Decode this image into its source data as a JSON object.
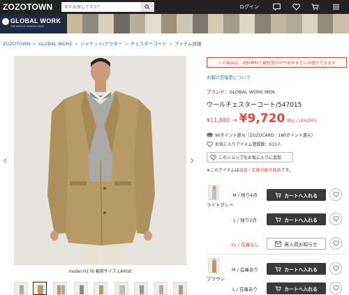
{
  "header": {
    "logo": "ZOZOTOWN",
    "search_placeholder": "何かお探しですか？",
    "login": "ログイン",
    "icons": [
      "search-icon",
      "message-icon",
      "heart-icon",
      "cart-icon",
      "menu-icon"
    ]
  },
  "banner": {
    "brand": "GLOBAL WORK",
    "tagline": "THE WORLD FASHION MART"
  },
  "breadcrumb": [
    "ZOZOTOWN",
    "GLOBAL WORK",
    "ジャケット/アウター",
    "チェスターコート",
    "アイテム詳細"
  ],
  "product": {
    "caption": "model:H178 着用サイズ:LARGE",
    "notice": "この商品は、送料無料で最短翌日の午前中までにお届けできます",
    "delivery_link": "お届け日指定について",
    "brand_line": "ブランド：GLOBAL WORK MEN",
    "title": "ウールチェスターコート/547015",
    "price_old": "¥11,880",
    "price_arrow": "→",
    "price_new": "¥9,720",
    "price_tax": "税込",
    "price_off": "(18%OFF)",
    "points": "90ポイント還元（ZOZOCARD：180ポイント還元）",
    "favorites": "お気に入りアイテム登録数：915人",
    "shop_fav": "このショップをお気に入りに追加",
    "return_note": {
      "prefix": "※このアイテムは",
      "highlight": "返品・交換対象外商品",
      "suffix": "です。"
    }
  },
  "variants": [
    {
      "color": "ライトグレー",
      "sizes": [
        {
          "label": "M / 残り4点",
          "action": "カートへ入れる",
          "type": "cart",
          "red": false
        },
        {
          "label": "L / 残り2点",
          "action": "カートへ入れる",
          "type": "cart",
          "red": false
        },
        {
          "label": "XL / 在庫なし",
          "action": "再入荷お知らせ",
          "type": "restock",
          "red": true
        }
      ]
    },
    {
      "color": "ブラウン",
      "sizes": [
        {
          "label": "M / 在庫あり",
          "action": "カートへ入れる",
          "type": "cart",
          "red": false
        },
        {
          "label": "L / 在庫あり",
          "action": "カートへ入れる",
          "type": "cart",
          "red": false
        }
      ]
    }
  ],
  "colors": {
    "accent": "#d84b3e",
    "link": "#2a6cb0",
    "header_bg": "#222222",
    "cart_button": "#3a3a3a",
    "coat": "#b79b64"
  }
}
